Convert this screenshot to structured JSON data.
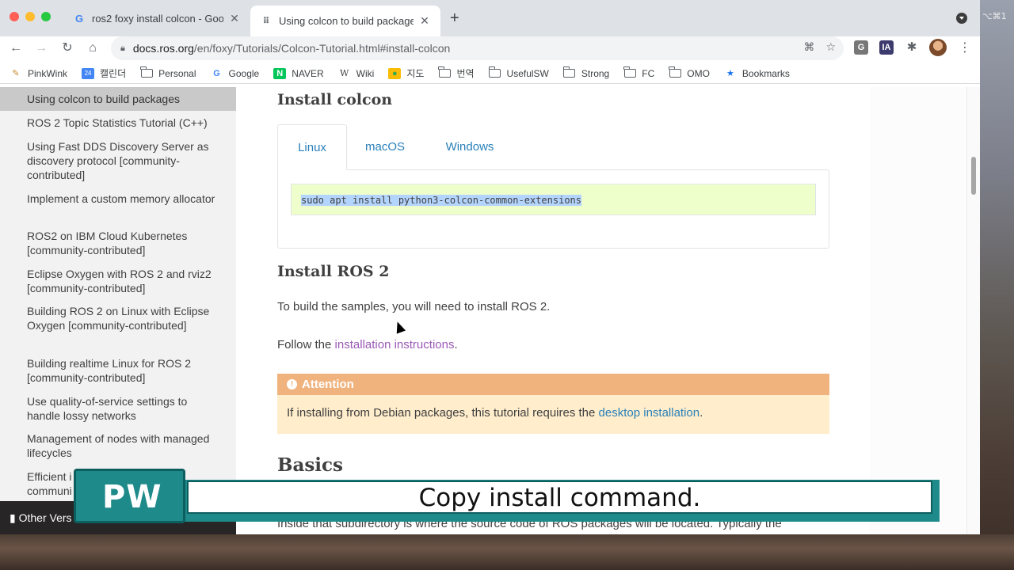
{
  "browser": {
    "tabs": [
      {
        "title": "ros2 foxy install colcon - Goog",
        "favicon": "google-g"
      },
      {
        "title": "Using colcon to build packages",
        "favicon": "ros-grid"
      }
    ],
    "url_host": "docs.ros.org",
    "url_path": "/en/foxy/Tutorials/Colcon-Tutorial.html#install-colcon",
    "keyboard_indicator": "⌥⌘1"
  },
  "bookmarks": [
    {
      "label": "PinkWink",
      "icon": "pen-icon"
    },
    {
      "label": "캘린더",
      "icon": "calendar-icon"
    },
    {
      "label": "Personal",
      "icon": "folder-icon"
    },
    {
      "label": "Google",
      "icon": "google-icon"
    },
    {
      "label": "NAVER",
      "icon": "naver-icon"
    },
    {
      "label": "Wiki",
      "icon": "wiki-icon"
    },
    {
      "label": "지도",
      "icon": "map-pin-icon"
    },
    {
      "label": "번역",
      "icon": "folder-icon"
    },
    {
      "label": "UsefulSW",
      "icon": "folder-icon"
    },
    {
      "label": "Strong",
      "icon": "folder-icon"
    },
    {
      "label": "FC",
      "icon": "folder-icon"
    },
    {
      "label": "OMO",
      "icon": "folder-icon"
    },
    {
      "label": "Bookmarks",
      "icon": "star-icon"
    }
  ],
  "sidebar": {
    "current": "Using colcon to build packages",
    "items": [
      "ROS 2 Topic Statistics Tutorial (C++)",
      "Using Fast DDS Discovery Server as discovery protocol [community-contributed]",
      "Implement a custom memory allocator",
      "ROS2 on IBM Cloud Kubernetes [community-contributed]",
      "Eclipse Oxygen with ROS 2 and rviz2 [community-contributed]",
      "Building ROS 2 on Linux with Eclipse Oxygen [community-contributed]",
      "Building realtime Linux for ROS 2 [community-contributed]",
      "Use quality-of-service settings to handle lossy networks",
      "Management of nodes with managed lifecycles",
      "Efficient i communi"
    ],
    "other_versions": "Other Vers"
  },
  "content": {
    "install_colcon_heading": "Install colcon",
    "code_tabs": [
      "Linux",
      "macOS",
      "Windows"
    ],
    "code": "sudo apt install python3-colcon-common-extensions",
    "install_ros_heading": "Install ROS 2",
    "install_ros_text": "To build the samples, you will need to install ROS 2.",
    "follow_prefix": "Follow the ",
    "follow_link": "installation instructions",
    "follow_suffix": ".",
    "attention_title": "Attention",
    "attention_prefix": "If installing from Debian packages, this tutorial requires the ",
    "attention_link": "desktop installation",
    "attention_suffix": ".",
    "basics_heading": "Basics",
    "cut_text": "Inside that subdirectory is where the source code of ROS packages will be located. Typically the"
  },
  "overlay": {
    "logo": "PW",
    "caption": "Copy install command."
  }
}
